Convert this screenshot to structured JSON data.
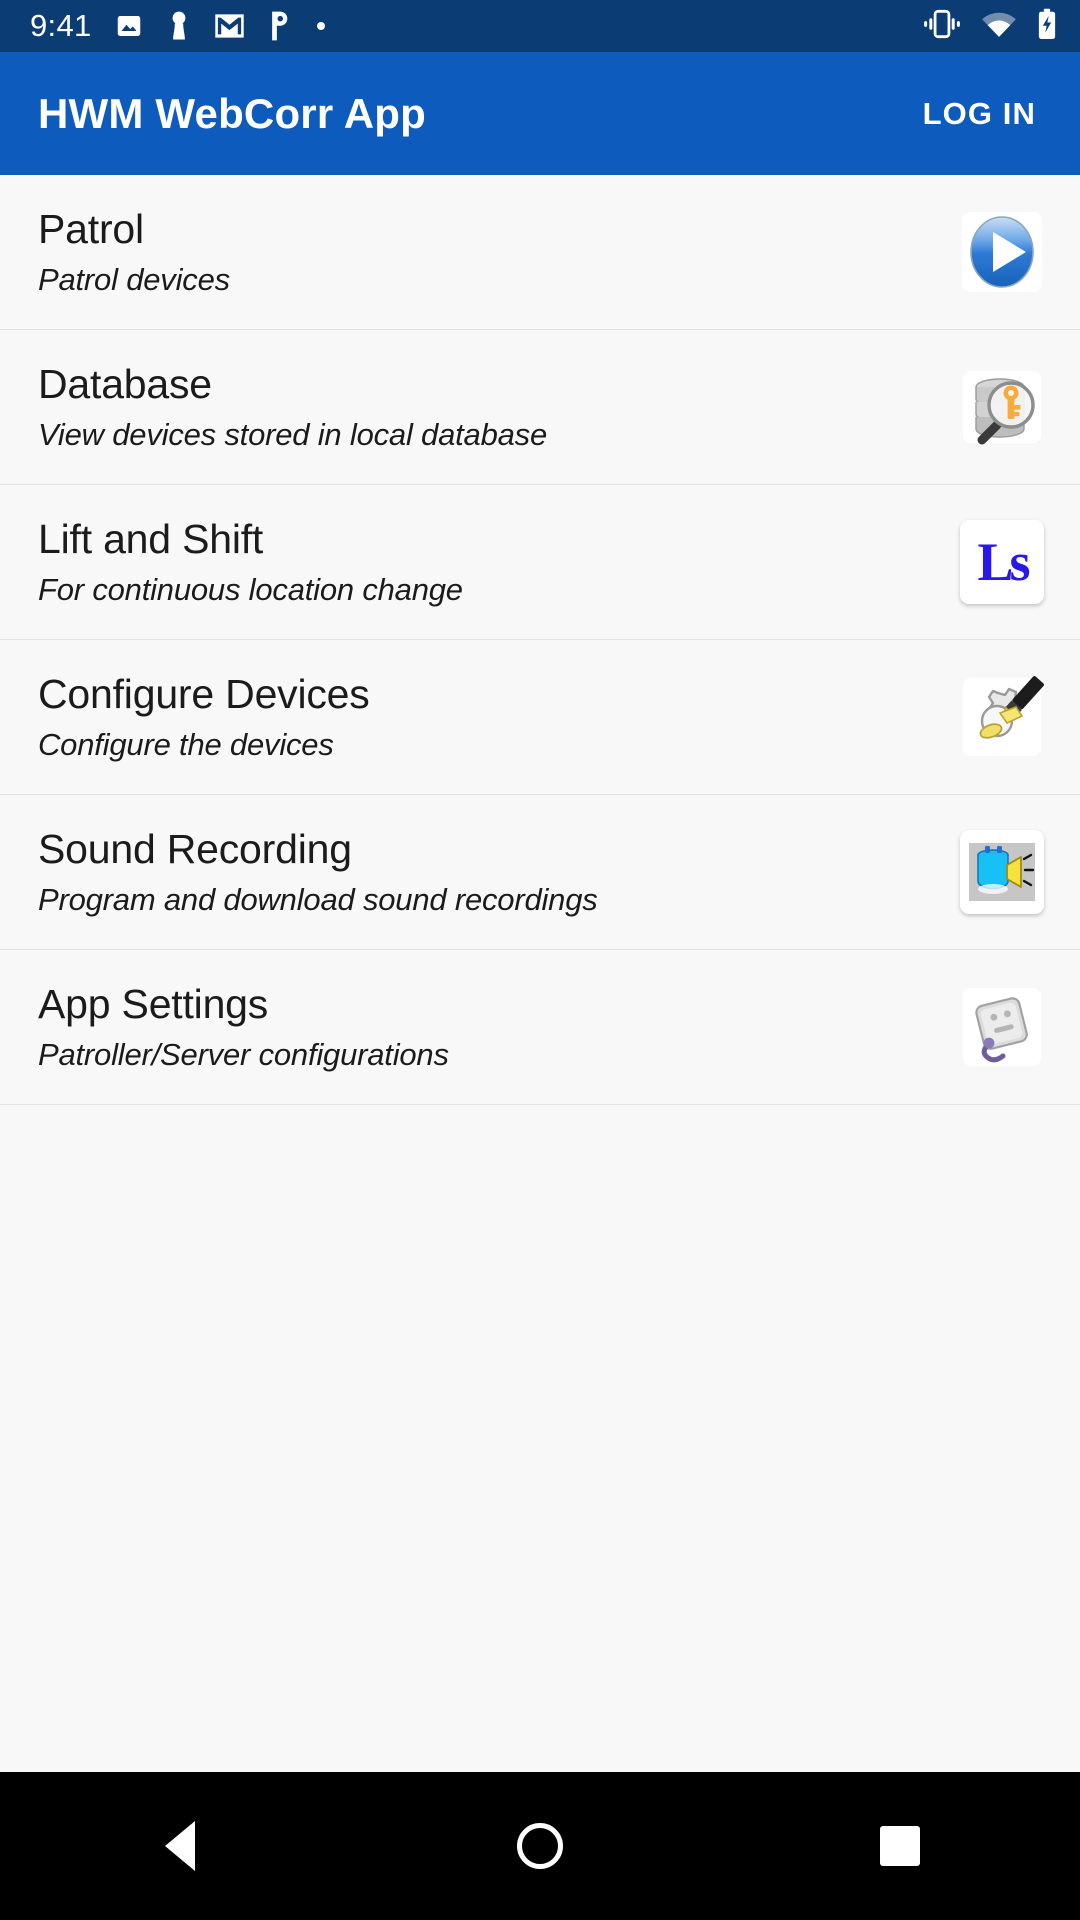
{
  "status_bar": {
    "time": "9:41",
    "left_icons": [
      "image-icon",
      "keyhole-icon",
      "gmail-icon",
      "letter-p-icon",
      "dot-icon"
    ],
    "right_icons": [
      "vibrate-icon",
      "wifi-icon",
      "battery-charging-icon"
    ],
    "background_color": "#0b3d74"
  },
  "app_bar": {
    "title": "HWM WebCorr App",
    "login_label": "LOG IN",
    "background_color": "#0d5bbd"
  },
  "menu": {
    "items": [
      {
        "title": "Patrol",
        "subtitle": "Patrol devices",
        "icon": "play-button-icon"
      },
      {
        "title": "Database",
        "subtitle": "View devices stored in local database",
        "icon": "database-search-key-icon"
      },
      {
        "title": "Lift and Shift",
        "subtitle": "For continuous location change",
        "icon": "ls-logo-icon",
        "icon_text": "Ls",
        "icon_color": "#2a18e8"
      },
      {
        "title": "Configure Devices",
        "subtitle": "Configure the devices",
        "icon": "gear-pen-icon"
      },
      {
        "title": "Sound Recording",
        "subtitle": "Program and download sound recordings",
        "icon": "speaker-device-icon"
      },
      {
        "title": "App Settings",
        "subtitle": "Patroller/Server configurations",
        "icon": "settings-plug-icon"
      }
    ]
  },
  "nav_bar": {
    "back_label": "back-button",
    "home_label": "home-button",
    "recents_label": "recents-button",
    "background_color": "#000000"
  }
}
